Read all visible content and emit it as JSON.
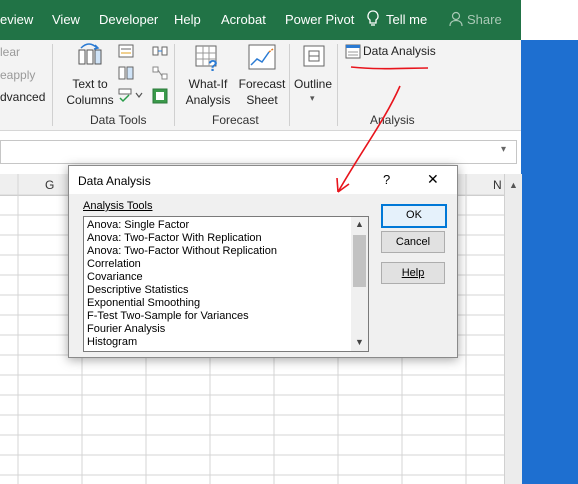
{
  "menu": {
    "items": [
      "eview",
      "View",
      "Developer",
      "Help",
      "Acrobat",
      "Power Pivot"
    ],
    "tell_me": "Tell me",
    "share": "Share"
  },
  "ribbon": {
    "left_items": [
      "lear",
      "eapply",
      "dvanced"
    ],
    "data_tools": {
      "text_to_columns": [
        "Text to",
        "Columns"
      ],
      "label": "Data Tools"
    },
    "forecast": {
      "what_if": [
        "What-If",
        "Analysis"
      ],
      "forecast_sheet": [
        "Forecast",
        "Sheet"
      ],
      "label": "Forecast"
    },
    "outline": {
      "label": "Outline"
    },
    "analysis": {
      "data_analysis": "Data Analysis",
      "label": "Analysis"
    }
  },
  "sheet": {
    "visible_columns": [
      "G",
      "N"
    ]
  },
  "dialog": {
    "title": "Data Analysis",
    "help_glyph": "?",
    "close_glyph": "✕",
    "list_label": "Analysis Tools",
    "tools": [
      "Anova: Single Factor",
      "Anova: Two-Factor With Replication",
      "Anova: Two-Factor Without Replication",
      "Correlation",
      "Covariance",
      "Descriptive Statistics",
      "Exponential Smoothing",
      "F-Test Two-Sample for Variances",
      "Fourier Analysis",
      "Histogram"
    ],
    "buttons": {
      "ok": "OK",
      "cancel": "Cancel",
      "help": "Help"
    }
  },
  "colors": {
    "excel_green": "#217346",
    "annotation_red": "#e8141c",
    "desktop_blue": "#1e6fd0",
    "focus_blue": "#0078d7"
  },
  "icons": [
    "lightbulb-icon",
    "person-icon",
    "text-to-columns-icon",
    "what-if-icon",
    "forecast-sheet-icon",
    "outline-icon",
    "data-analysis-icon"
  ]
}
